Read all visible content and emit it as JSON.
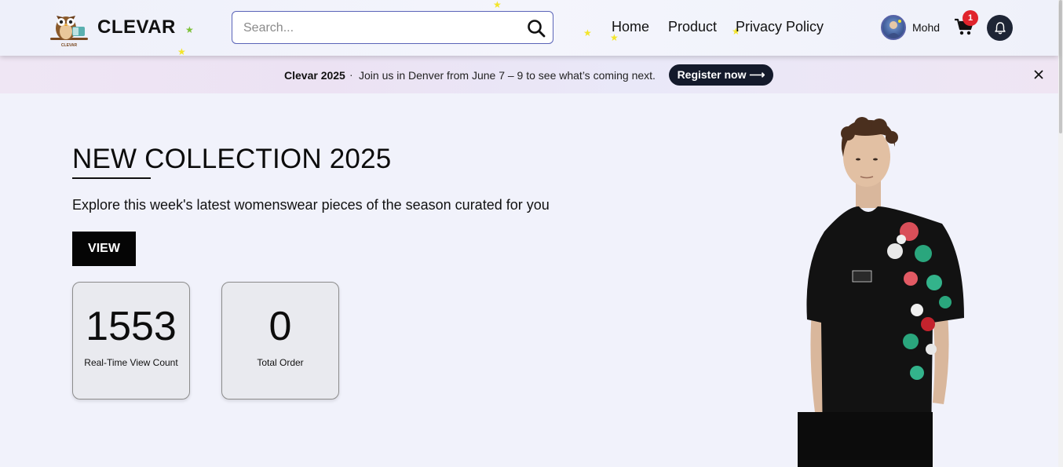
{
  "header": {
    "brand": "CLEVAR",
    "logo_caption": "CLEVAR",
    "search": {
      "placeholder": "Search...",
      "value": ""
    },
    "nav": [
      {
        "label": "Home"
      },
      {
        "label": "Product"
      },
      {
        "label": "Privacy Policy"
      }
    ],
    "user": {
      "name": "Mohd"
    },
    "cart": {
      "count": "1"
    }
  },
  "announcement": {
    "event": "Clevar 2025",
    "separator": "·",
    "message": "Join us in Denver from June 7 – 9 to see what’s coming next.",
    "cta": "Register now ⟶"
  },
  "hero": {
    "title": "NEW COLLECTION 2025",
    "subtitle": "Explore this week's latest womenswear pieces of the season curated for you",
    "cta": "VIEW",
    "stats": [
      {
        "value": "1553",
        "label": "Real-Time View Count"
      },
      {
        "value": "0",
        "label": "Total Order"
      }
    ]
  },
  "colors": {
    "accent_dark": "#141a2b",
    "badge_red": "#e0242c",
    "search_border": "#5a64b8",
    "star_yellow": "#f3e52a",
    "star_green": "#7dc23a"
  },
  "icons": [
    "owl-logo-icon",
    "search-icon",
    "cart-icon",
    "bell-icon",
    "close-icon",
    "star-icon"
  ]
}
